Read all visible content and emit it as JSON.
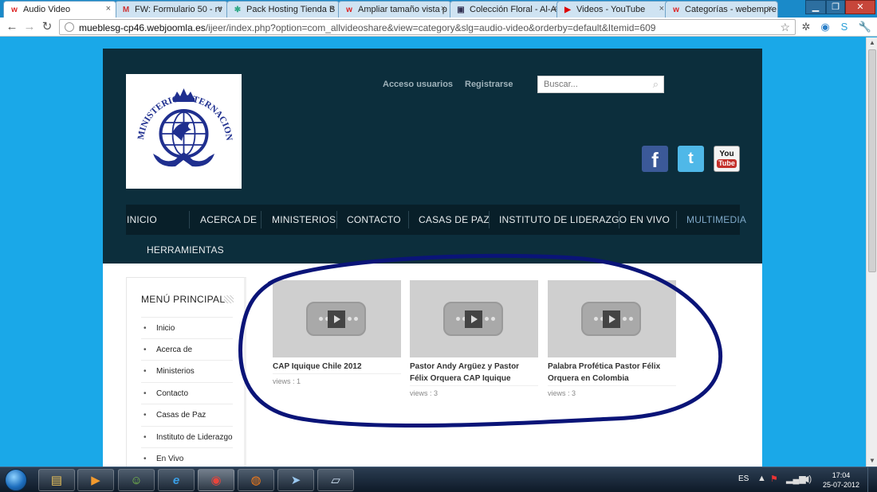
{
  "browser": {
    "tabs": [
      {
        "title": "Audio Video",
        "favicon": "w-icon",
        "icon_text": "w",
        "color": "#d22"
      },
      {
        "title": "FW: Formulario 50 - rv",
        "favicon": "gmail-icon",
        "icon_text": "M",
        "color": "#c33"
      },
      {
        "title": "Pack Hosting Tienda B",
        "favicon": "joomla-icon",
        "icon_text": "✱",
        "color": "#3a8"
      },
      {
        "title": "Ampliar tamaño vista p",
        "favicon": "w-icon",
        "icon_text": "w",
        "color": "#d22"
      },
      {
        "title": "Colección Floral - Al-A",
        "favicon": "page-icon",
        "icon_text": "▣",
        "color": "#335"
      },
      {
        "title": "Videos - YouTube",
        "favicon": "youtube-icon",
        "icon_text": "▶",
        "color": "#d00"
      },
      {
        "title": "Categorías - webempre",
        "favicon": "w-icon",
        "icon_text": "w",
        "color": "#d22"
      }
    ],
    "tab_close_glyph": "×",
    "address": {
      "domain": "mueblesg-cp46.webjoomla.es",
      "path": "/ijeer/index.php?option=com_allvideoshare&view=category&slg=audio-video&orderby=default&Itemid=609"
    }
  },
  "site": {
    "logo_text": "MINISTERIO INTERNACIONAL JESÚS ES EL REY",
    "top_links": [
      "Acceso usuarios",
      "Registrarse"
    ],
    "search": {
      "placeholder": "Buscar...",
      "value": "Buscar..."
    },
    "social": [
      {
        "name": "facebook",
        "label": "f",
        "color": "#3b5998"
      },
      {
        "name": "twitter",
        "label": "t",
        "color": "#4fb8e8"
      },
      {
        "name": "youtube",
        "label_top": "You",
        "label_bottom": "Tube",
        "color": "#c4302b"
      }
    ],
    "main_menu": [
      "INICIO",
      "ACERCA DE",
      "MINISTERIOS",
      "CONTACTO",
      "CASAS DE PAZ",
      "INSTITUTO DE LIDERAZGO",
      "EN VIVO",
      "MULTIMEDIA"
    ],
    "main_menu_active": "MULTIMEDIA",
    "main_menu_row2": "HERRAMIENTAS",
    "sidebar": {
      "title": "MENÚ PRINCIPAL",
      "items": [
        "Inicio",
        "Acerca de",
        "Ministerios",
        "Contacto",
        "Casas de Paz",
        "Instituto de Liderazgo",
        "En Vivo"
      ]
    },
    "videos": [
      {
        "title": "CAP Iquique Chile 2012",
        "views_label": "views :",
        "views": "1"
      },
      {
        "title": "Pastor Andy Argüez y Pastor Félix Orquera CAP Iquique",
        "views_label": "views :",
        "views": "3"
      },
      {
        "title": "Palabra Profética Pastor Félix Orquera en Colombia",
        "views_label": "views :",
        "views": "3"
      }
    ],
    "annotation_color": "#0a1478"
  },
  "taskbar": {
    "apps": [
      {
        "name": "explorer",
        "glyph": "▤",
        "color": "#e8c15a"
      },
      {
        "name": "media-player",
        "glyph": "▶",
        "color": "#f29a2e"
      },
      {
        "name": "messenger",
        "glyph": "☺",
        "color": "#7bc24a"
      },
      {
        "name": "internet-explorer",
        "glyph": "e",
        "color": "#3aa0e8"
      },
      {
        "name": "chrome",
        "glyph": "◉",
        "color": "#e8453c"
      },
      {
        "name": "firefox",
        "glyph": "◍",
        "color": "#f07a1a"
      },
      {
        "name": "send",
        "glyph": "➤",
        "color": "#9ac8f0"
      },
      {
        "name": "notes",
        "glyph": "▱",
        "color": "#cfe2f5"
      }
    ],
    "language": "ES",
    "time": "17:04",
    "date": "25-07-2012"
  }
}
